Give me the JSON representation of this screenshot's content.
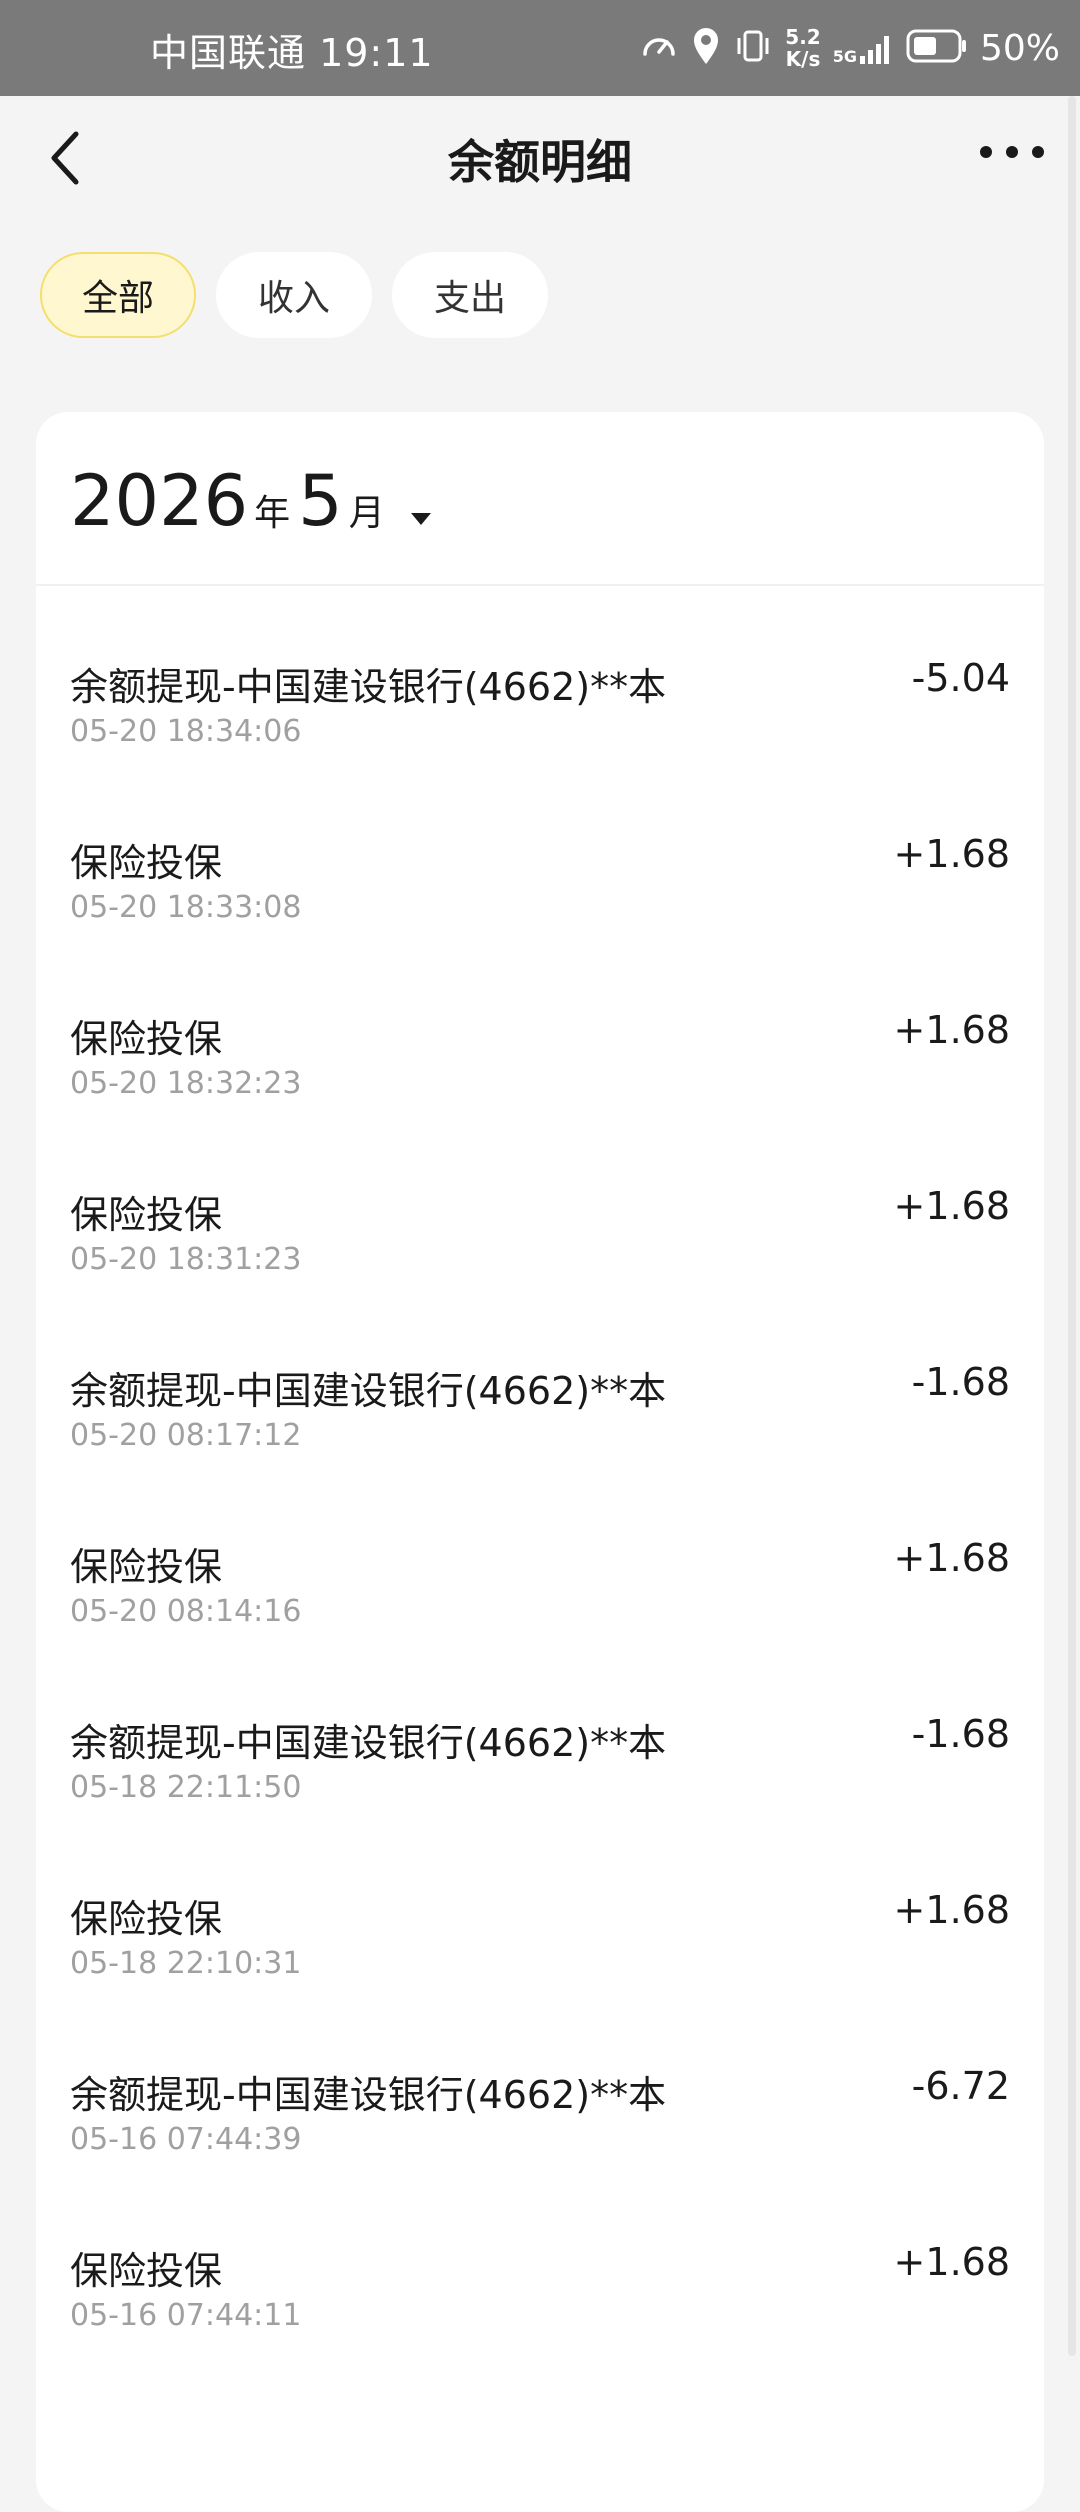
{
  "status_bar": {
    "carrier_time": "中国联通 19:11",
    "net_speed_value": "5.2",
    "net_speed_unit": "K/s",
    "signal_label": "5G",
    "battery_percent": "50%",
    "icons": [
      "speedometer-icon",
      "location-icon",
      "vibrate-icon",
      "signal-icon",
      "battery-icon"
    ]
  },
  "header": {
    "title": "余额明细"
  },
  "filters": [
    {
      "label": "全部",
      "active": true
    },
    {
      "label": "收入",
      "active": false
    },
    {
      "label": "支出",
      "active": false
    }
  ],
  "month_selector": {
    "year": "2026",
    "year_unit": "年",
    "month": "5",
    "month_unit": "月"
  },
  "transactions": [
    {
      "title": "余额提现-中国建设银行(4662)**本",
      "time": "05-20 18:34:06",
      "amount": "-5.04"
    },
    {
      "title": "保险投保",
      "time": "05-20 18:33:08",
      "amount": "+1.68"
    },
    {
      "title": "保险投保",
      "time": "05-20 18:32:23",
      "amount": "+1.68"
    },
    {
      "title": "保险投保",
      "time": "05-20 18:31:23",
      "amount": "+1.68"
    },
    {
      "title": "余额提现-中国建设银行(4662)**本",
      "time": "05-20 08:17:12",
      "amount": "-1.68"
    },
    {
      "title": "保险投保",
      "time": "05-20 08:14:16",
      "amount": "+1.68"
    },
    {
      "title": "余额提现-中国建设银行(4662)**本",
      "time": "05-18 22:11:50",
      "amount": "-1.68"
    },
    {
      "title": "保险投保",
      "time": "05-18 22:10:31",
      "amount": "+1.68"
    },
    {
      "title": "余额提现-中国建设银行(4662)**本",
      "time": "05-16 07:44:39",
      "amount": "-6.72"
    },
    {
      "title": "保险投保",
      "time": "05-16 07:44:11",
      "amount": "+1.68"
    }
  ],
  "colors": {
    "active_chip_bg": "#fff7cf",
    "active_chip_border": "#f3df6f",
    "status_bar_bg": "#7a7a7a"
  }
}
